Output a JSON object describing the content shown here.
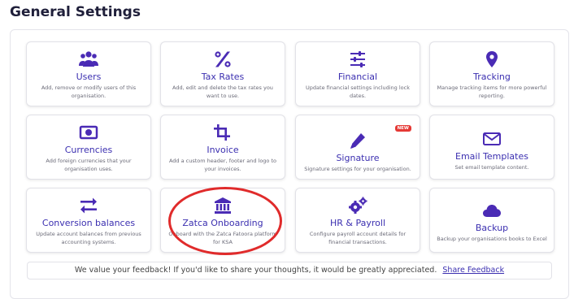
{
  "page_title": "General Settings",
  "colors": {
    "accent": "#3b2fb0",
    "icon": "#4a2bb5",
    "badge": "#e53935",
    "highlight": "#e02b2b"
  },
  "cards": [
    {
      "key": "users",
      "icon": "users-icon",
      "title": "Users",
      "desc": "Add, remove or modify users of this organisation."
    },
    {
      "key": "tax-rates",
      "icon": "percent-icon",
      "title": "Tax Rates",
      "desc": "Add, edit and delete the tax rates you want to use."
    },
    {
      "key": "financial",
      "icon": "sliders-icon",
      "title": "Financial",
      "desc": "Update financial settings including lock dates."
    },
    {
      "key": "tracking",
      "icon": "map-pin-icon",
      "title": "Tracking",
      "desc": "Manage tracking items for more powerful reporting."
    },
    {
      "key": "currencies",
      "icon": "banknote-icon",
      "title": "Currencies",
      "desc": "Add foreign currencies that your organisation uses."
    },
    {
      "key": "invoice",
      "icon": "crop-icon",
      "title": "Invoice",
      "desc": "Add a custom header, footer and logo to your invoices."
    },
    {
      "key": "signature",
      "icon": "pencil-icon",
      "title": "Signature",
      "desc": "Signature settings for your organisation.",
      "badge": "NEW"
    },
    {
      "key": "email-templates",
      "icon": "envelope-icon",
      "title": "Email Templates",
      "desc": "Set email template content."
    },
    {
      "key": "conversion-balances",
      "icon": "arrows-exchange-icon",
      "title": "Conversion balances",
      "desc": "Update account balances from previous accounting systems."
    },
    {
      "key": "zatca-onboarding",
      "icon": "bank-icon",
      "title": "Zatca Onboarding",
      "desc": "Onboard with the Zatca Fatoora platform for KSA"
    },
    {
      "key": "hr-payroll",
      "icon": "cogs-icon",
      "title": "HR & Payroll",
      "desc": "Configure payroll account details for financial transactions."
    },
    {
      "key": "backup",
      "icon": "cloud-icon",
      "title": "Backup",
      "desc": "Backup your organisations books to Excel"
    }
  ],
  "feedback": {
    "text": "We value your feedback! If you'd like to share your thoughts, it would be greatly appreciated.",
    "link": "Share Feedback"
  }
}
